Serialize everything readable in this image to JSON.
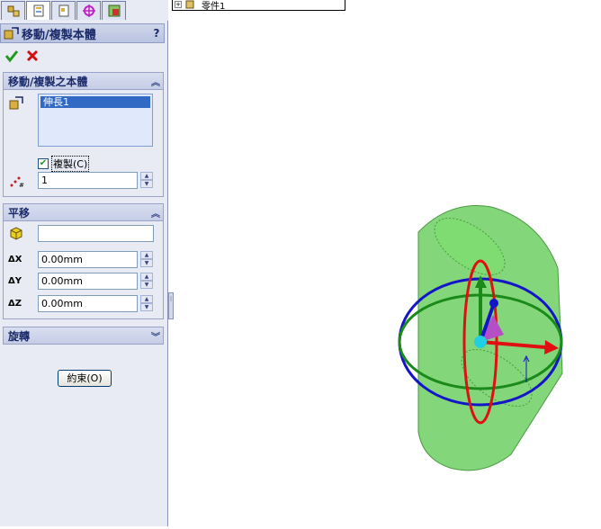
{
  "panel": {
    "title": "移動/複製本體",
    "help": "?",
    "groups": {
      "move_copy": {
        "header": "移動/複製之本體",
        "bodies": [
          "伸長1"
        ],
        "copy_label": "複製(C)",
        "copy_checked": true,
        "copy_count": "1"
      },
      "translate": {
        "header": "平移",
        "vertex_value": "",
        "dx_label": "ΔX",
        "dx_value": "0.00mm",
        "dy_label": "ΔY",
        "dy_value": "0.00mm",
        "dz_label": "ΔZ",
        "dz_value": "0.00mm"
      },
      "rotate": {
        "header": "旋轉"
      }
    },
    "finish_button": "約束(O)"
  },
  "tree_popup": {
    "item": "零件1"
  },
  "viewport": {
    "body_color": "#6fcf64",
    "triad_colors": {
      "x": "#e01010",
      "y": "#1a8a1a",
      "z": "#1414c8"
    }
  }
}
